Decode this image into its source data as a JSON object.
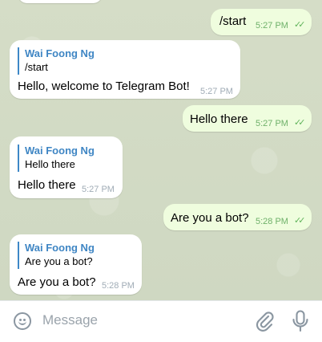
{
  "messages": [
    {
      "direction": "out",
      "text": "/start",
      "time": "5:27 PM",
      "status": "read"
    },
    {
      "direction": "in",
      "reply_to_name": "Wai Foong Ng",
      "reply_to_text": "/start",
      "text": "Hello, welcome to Telegram Bot!",
      "time": "5:27 PM"
    },
    {
      "direction": "out",
      "text": "Hello there",
      "time": "5:27 PM",
      "status": "read"
    },
    {
      "direction": "in",
      "reply_to_name": "Wai Foong Ng",
      "reply_to_text": "Hello there",
      "text": "Hello there",
      "time": "5:27 PM"
    },
    {
      "direction": "out",
      "text": "Are you a bot?",
      "time": "5:28 PM",
      "status": "read"
    },
    {
      "direction": "in",
      "reply_to_name": "Wai Foong Ng",
      "reply_to_text": "Are you a bot?",
      "text": "Are you a bot?",
      "time": "5:28 PM"
    }
  ],
  "input": {
    "placeholder": "Message",
    "left_icon": "emoji-icon",
    "right_icons": [
      "attach-icon",
      "microphone-icon"
    ]
  },
  "colors": {
    "outgoing_bubble": "#effdde",
    "incoming_bubble": "#ffffff",
    "reply_accent": "#3f86c4",
    "read_check": "#5fb35a",
    "chat_background": "#d3dcc5"
  }
}
